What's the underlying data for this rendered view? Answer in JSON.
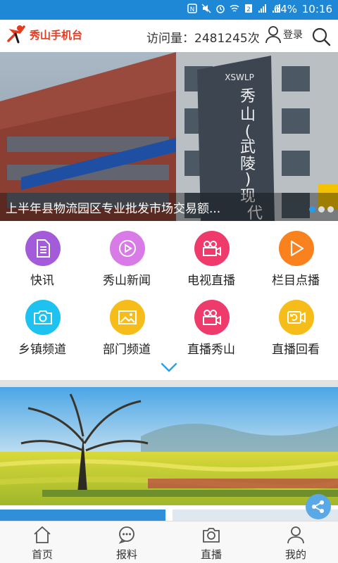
{
  "status_bar": {
    "battery": "64%",
    "time": "10:16"
  },
  "header": {
    "app_name": "秀山手机台",
    "visits_label": "访问量：",
    "visits_count": "2481245次",
    "login_label": "登录",
    "brand_color": "#e63a1e"
  },
  "banner": {
    "caption": "上半年县物流园区专业批发市场交易额...",
    "sign_text": "秀山(武陵)现代物流园区",
    "slide_count": 3,
    "active_slide": 1
  },
  "grid": {
    "items": [
      {
        "label": "快讯",
        "icon": "document-icon",
        "color": "#a35bd9"
      },
      {
        "label": "秀山新闻",
        "icon": "play-circle-icon",
        "color": "#d97be6"
      },
      {
        "label": "电视直播",
        "icon": "video-camera-icon",
        "color": "#ef3a6c"
      },
      {
        "label": "栏目点播",
        "icon": "play-icon",
        "color": "#f9821f"
      },
      {
        "label": "乡镇频道",
        "icon": "camera-icon",
        "color": "#1ec2f0"
      },
      {
        "label": "部门频道",
        "icon": "image-icon",
        "color": "#f6bd1a"
      },
      {
        "label": "直播秀山",
        "icon": "video-camera-icon",
        "color": "#ef3a6c"
      },
      {
        "label": "直播回看",
        "icon": "replay-camera-icon",
        "color": "#f6bd1a"
      }
    ]
  },
  "bottom_nav": {
    "items": [
      {
        "label": "首页",
        "icon": "home-icon"
      },
      {
        "label": "报料",
        "icon": "chat-bubble-icon"
      },
      {
        "label": "直播",
        "icon": "camera-icon"
      },
      {
        "label": "我的",
        "icon": "user-icon"
      }
    ]
  }
}
